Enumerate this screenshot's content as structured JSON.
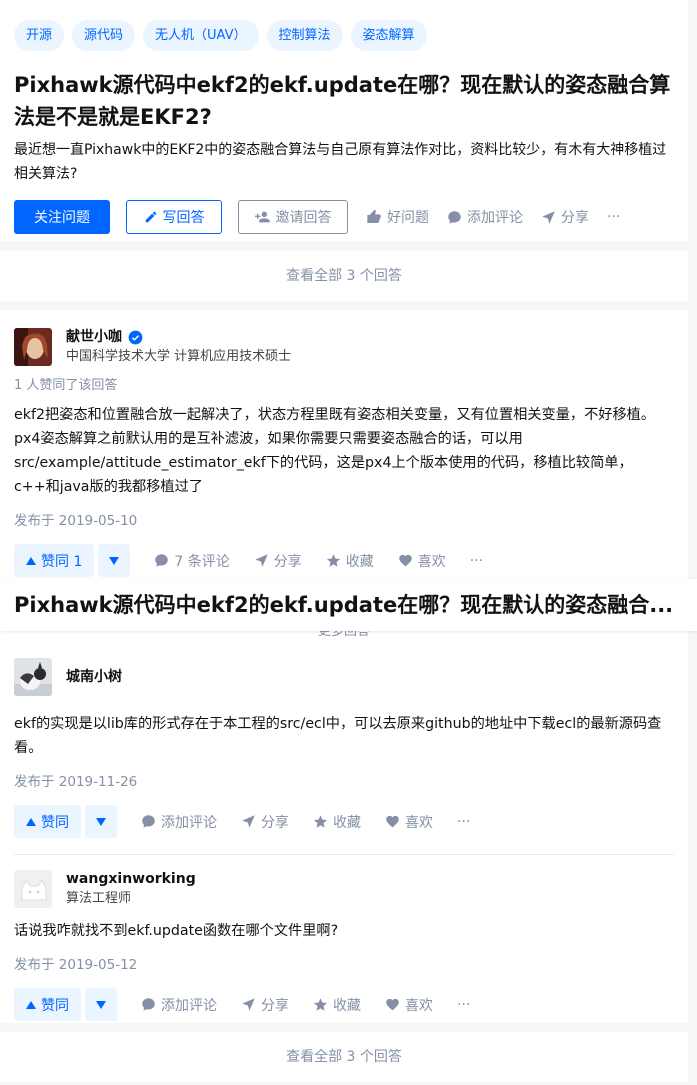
{
  "question": {
    "tags": [
      "开源",
      "源代码",
      "无人机（UAV）",
      "控制算法",
      "姿态解算"
    ],
    "title": "Pixhawk源代码中ekf2的ekf.update在哪？现在默认的姿态融合算法是不是就是EKF2?",
    "description": "最近想一直Pixhawk中的EKF2中的姿态融合算法与自己原有算法作对比，资料比较少，有木有大神移植过相关算法?",
    "follow_label": "关注问题",
    "write_label": "写回答",
    "invite_label": "邀请回答",
    "good_label": "好问题",
    "comment_label": "添加评论",
    "share_label": "分享",
    "more_label": "···"
  },
  "view_all_label": "查看全部 3 个回答",
  "sticky_title": "Pixhawk源代码中ekf2的ekf.update在哪？现在默认的姿态融合...",
  "more_answers_label": "更多回答",
  "answers": [
    {
      "author": "献世小咖",
      "bio": "中国科学技术大学 计算机应用技术硕士",
      "voters": "1 人赞同了该回答",
      "content": "ekf2把姿态和位置融合放一起解决了，状态方程里既有姿态相关变量，又有位置相关变量，不好移植。px4姿态解算之前默认用的是互补滤波，如果你需要只需要姿态融合的话，可以用src/example/attitude_estimator_ekf下的代码，这是px4上个版本使用的代码，移植比较简单，c++和java版的我都移植过了",
      "date": "发布于 2019-05-10",
      "vote_label": "赞同 1",
      "comment_label": "7 条评论",
      "share_label": "分享",
      "collect_label": "收藏",
      "like_label": "喜欢",
      "more_label": "···"
    },
    {
      "author": "城南小树",
      "bio": "",
      "content": "ekf的实现是以lib库的形式存在于本工程的src/ecl中，可以去原来github的地址中下载ecl的最新源码查看。",
      "date": "发布于 2019-11-26",
      "vote_label": "赞同",
      "comment_label": "添加评论",
      "share_label": "分享",
      "collect_label": "收藏",
      "like_label": "喜欢",
      "more_label": "···"
    },
    {
      "author": "wangxinworking",
      "bio": "算法工程师",
      "content": "话说我咋就找不到ekf.update函数在哪个文件里啊?",
      "date": "发布于 2019-05-12",
      "vote_label": "赞同",
      "comment_label": "添加评论",
      "share_label": "分享",
      "collect_label": "收藏",
      "like_label": "喜欢",
      "more_label": "···"
    }
  ],
  "colors": {
    "brand": "#0066ff",
    "muted": "#8590a6",
    "vote_bg": "#ebf5ff"
  }
}
